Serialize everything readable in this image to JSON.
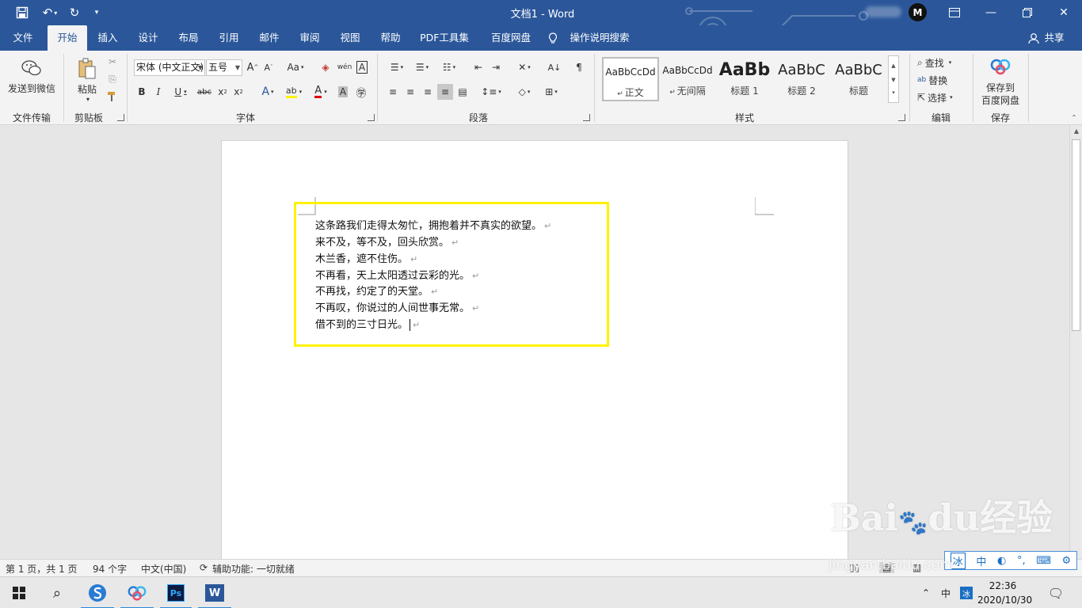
{
  "window": {
    "title": "文档1  -  Word",
    "share_label": "共享",
    "tell_me": "操作说明搜索",
    "avatar_initial": "M"
  },
  "menu": {
    "tabs": [
      {
        "label": "文件"
      },
      {
        "label": "开始",
        "active": true
      },
      {
        "label": "插入"
      },
      {
        "label": "设计"
      },
      {
        "label": "布局"
      },
      {
        "label": "引用"
      },
      {
        "label": "邮件"
      },
      {
        "label": "审阅"
      },
      {
        "label": "视图"
      },
      {
        "label": "帮助"
      },
      {
        "label": "PDF工具集"
      },
      {
        "label": "百度网盘"
      }
    ]
  },
  "ribbon": {
    "send_wechat": "发送到微信",
    "paste": "粘贴",
    "font_name": "宋体 (中文正文)",
    "font_size": "五号",
    "styles": [
      {
        "sample": "AaBbCcDd",
        "label": "正文"
      },
      {
        "sample": "AaBbCcDd",
        "label": "无间隔"
      },
      {
        "sample": "AaBb",
        "label": "标题 1"
      },
      {
        "sample": "AaBbC",
        "label": "标题 2"
      },
      {
        "sample": "AaBbC",
        "label": "标题"
      }
    ],
    "find": "查找",
    "replace": "替换",
    "select": "选择",
    "save_to": "保存到",
    "baidu_pan": "百度网盘",
    "groups": {
      "transfer": "文件传输",
      "clipboard": "剪贴板",
      "font": "字体",
      "paragraph": "段落",
      "styles": "样式",
      "editing": "编辑",
      "save": "保存"
    }
  },
  "document": {
    "lines": [
      "这条路我们走得太匆忙，拥抱着并不真实的欲望。",
      "来不及，等不及，回头欣赏。",
      "木兰香，遮不住伤。",
      "不再看，天上太阳透过云彩的光。",
      "不再找，约定了的天堂。",
      "不再叹，你说过的人间世事无常。",
      "借不到的三寸日光。"
    ],
    "highlight_color": "#fff200"
  },
  "status": {
    "page": "第 1 页，共 1 页",
    "words": "94 个字",
    "language": "中文(中国)",
    "accessibility": "辅助功能: 一切就绪"
  },
  "ime": {
    "ime_mode": "中",
    "tray_ime": "中"
  },
  "taskbar": {
    "time": "22:36",
    "date": "2020/10/30"
  },
  "watermark": {
    "brand": "Bai",
    "brand_rest": "du经验",
    "url": "jingyan.baidu.com"
  },
  "colors": {
    "accent": "#2b579a",
    "ribbon_bg": "#f3f3f3"
  }
}
